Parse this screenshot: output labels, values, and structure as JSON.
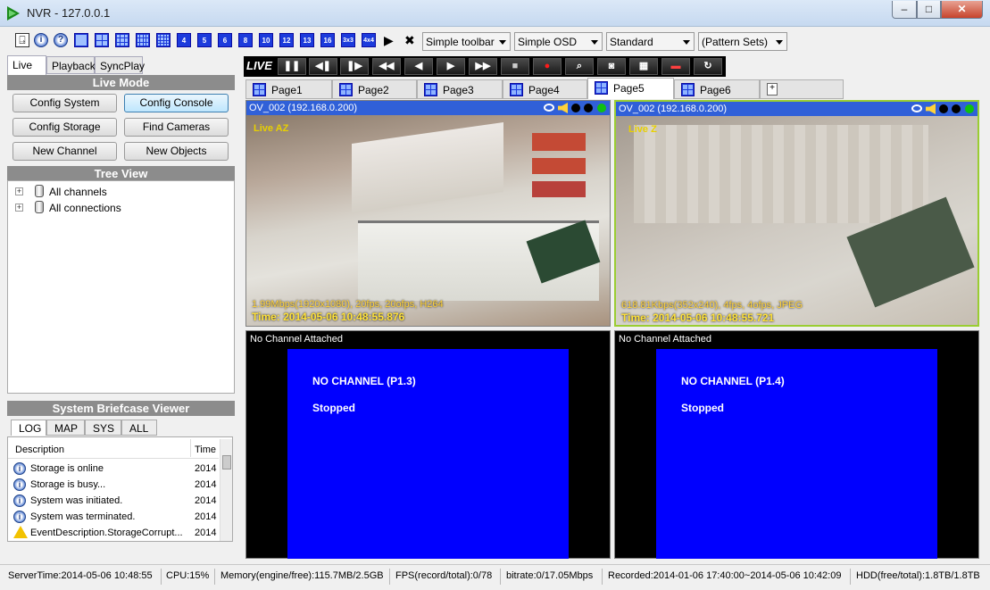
{
  "window": {
    "title": "NVR - 127.0.0.1",
    "minimize": "–",
    "maximize": "□",
    "close": "✕"
  },
  "toolbar": {
    "icons": [
      "exit-icon",
      "info-icon",
      "help-icon",
      "layout-1x1-icon",
      "layout-2x2-icon",
      "layout-3x3-icon",
      "layout-3x4-icon",
      "layout-4x4-icon"
    ],
    "num_layouts": [
      "4",
      "5",
      "6",
      "8",
      "10",
      "12",
      "13",
      "16",
      "3x3",
      "4x4"
    ],
    "play_glyph": "▶",
    "stop_glyph": "✖",
    "toolbar_select": "Simple toolbar",
    "osd_select": "Simple OSD",
    "standard_select": "Standard",
    "pattern_select": "(Pattern Sets)"
  },
  "left_tabs": [
    "Live",
    "Playback",
    "SyncPlay"
  ],
  "live_mode": {
    "title": "Live Mode",
    "buttons": [
      "Config System",
      "Config Console",
      "Config Storage",
      "Find Cameras",
      "New Channel",
      "New Objects"
    ]
  },
  "tree": {
    "title": "Tree View",
    "nodes": [
      "All channels",
      "All connections"
    ],
    "expander": "+"
  },
  "briefcase": {
    "title": "System Briefcase Viewer",
    "tabs": [
      "LOG",
      "MAP",
      "SYS",
      "ALL"
    ],
    "columns": [
      "Description",
      "Time"
    ],
    "rows": [
      {
        "icon": "info",
        "desc": "Storage is online",
        "time": "2014"
      },
      {
        "icon": "info",
        "desc": "Storage is busy...",
        "time": "2014"
      },
      {
        "icon": "info",
        "desc": "System was initiated.",
        "time": "2014"
      },
      {
        "icon": "info",
        "desc": "System was terminated.",
        "time": "2014"
      },
      {
        "icon": "warning",
        "desc": "EventDescription.StorageCorrupt...",
        "time": "2014"
      }
    ],
    "info_glyph": "i"
  },
  "playbar": {
    "live_label": "LIVE",
    "buttons": [
      "pause",
      "frame-back",
      "frame-forward",
      "rewind",
      "step-back",
      "play",
      "fast-forward",
      "stop",
      "record",
      "zoom",
      "snapshot",
      "grid",
      "osd",
      "refresh"
    ],
    "glyphs": [
      "❚❚",
      "◀❚",
      "❚▶",
      "◀◀",
      "◀",
      "▶",
      "▶▶",
      "■",
      "●",
      "⌕",
      "◙",
      "▦",
      "▬",
      "↻"
    ]
  },
  "pages": {
    "tabs": [
      "Page1",
      "Page2",
      "Page3",
      "Page4",
      "Page5",
      "Page6"
    ],
    "active": "Page5",
    "new_page_glyph": "+"
  },
  "cameras": [
    {
      "header": "OV_002 (192.168.0.200)",
      "label": "Live AZ",
      "stats": "1.99Mbps(1920x1080), 20fps, 20ofps, H264",
      "time": "Time: 2014-05-06 10:48:55.876"
    },
    {
      "header": "OV_002 (192.168.0.200)",
      "label": "Live Z",
      "stats": "618.81Kbps(352x240), 4fps, 4ofps, JPEG",
      "time": "Time: 2014-05-06 10:48:55.721"
    }
  ],
  "empty_channels": [
    {
      "header": "No Channel Attached",
      "title": "NO CHANNEL (P1.3)",
      "state": "Stopped"
    },
    {
      "header": "No Channel Attached",
      "title": "NO CHANNEL (P1.4)",
      "state": "Stopped"
    }
  ],
  "status": {
    "server_time": "ServerTime:2014-05-06 10:48:55",
    "cpu": "CPU:15%",
    "memory": "Memory(engine/free):115.7MB/2.5GB",
    "fps": "FPS(record/total):0/78",
    "bitrate": "bitrate:0/17.05Mbps",
    "recorded": "Recorded:2014-01-06 17:40:00~2014-05-06 10:42:09",
    "hdd": "HDD(free/total):1.8TB/1.8TB"
  },
  "colors": {
    "header_blue": "#3060d8",
    "no_channel_blue": "#0000ff",
    "selected_border": "#9acd32"
  }
}
